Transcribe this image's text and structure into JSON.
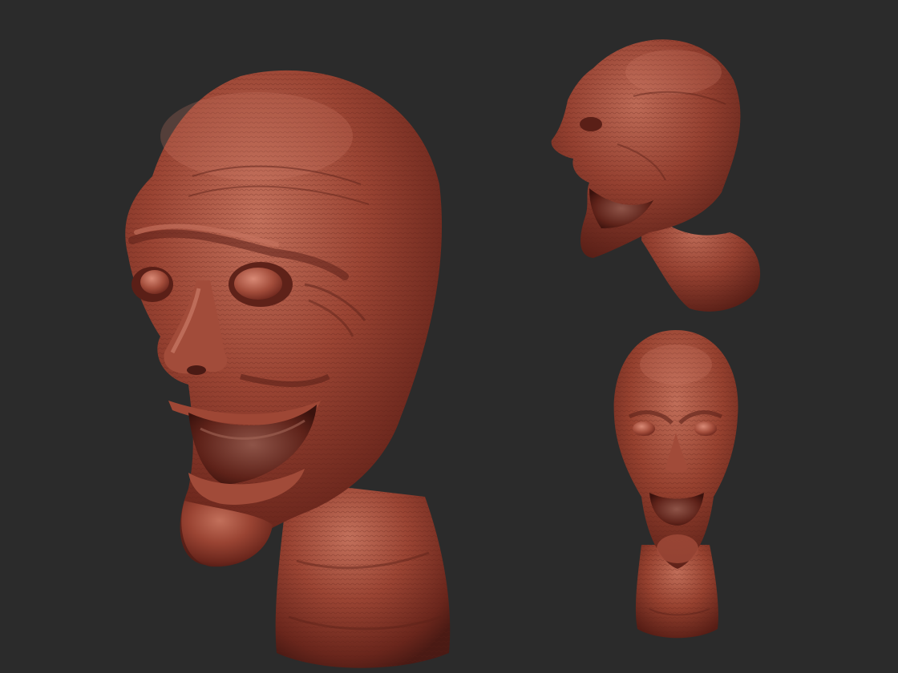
{
  "canvas": {
    "background_color": "#2b2b2b"
  },
  "material": {
    "base_color": "#8a3a2c",
    "highlight_color": "#c7705c",
    "shadow_color": "#4a1a14"
  },
  "views": [
    {
      "name": "three-quarter-view",
      "icon": "sculpt-head-three-quarter"
    },
    {
      "name": "profile-view",
      "icon": "sculpt-head-profile"
    },
    {
      "name": "front-view",
      "icon": "sculpt-head-front"
    }
  ]
}
